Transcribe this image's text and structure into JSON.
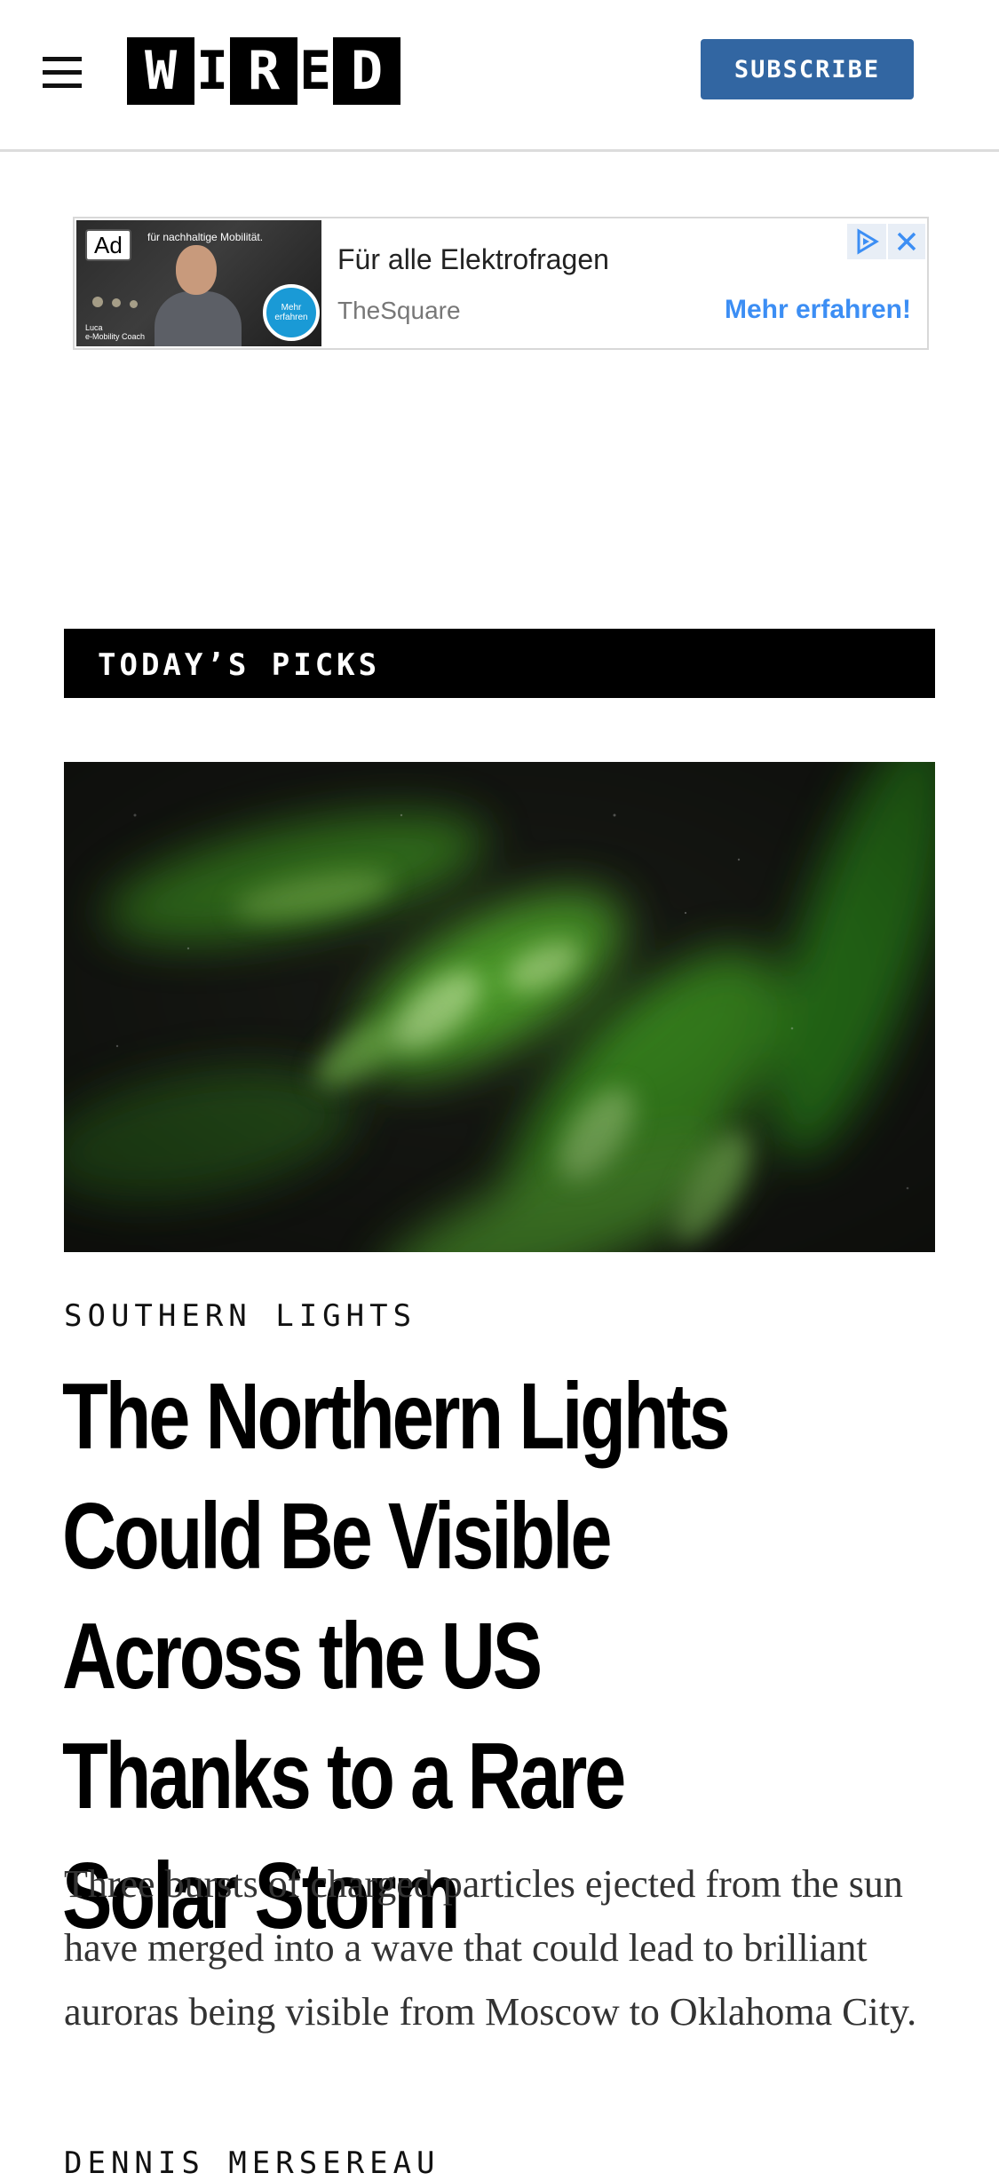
{
  "header": {
    "menu_icon": "hamburger-menu-icon",
    "logo_letters": [
      "W",
      "I",
      "R",
      "E",
      "D"
    ],
    "subscribe_label": "SUBSCRIBE",
    "subscribe_color": "#3266a2"
  },
  "ad": {
    "label": "Ad",
    "image_tagline": "für nachhaltige Mobilität.",
    "image_badge": "Mehr erfahren",
    "image_caption": "Luca\ne-Mobility Coach",
    "headline": "Für alle Elektrofragen",
    "source": "TheSquare",
    "cta": "Mehr erfahren!",
    "cta_color": "#3c8ef4",
    "adchoices_icon": "adchoices-icon",
    "close_icon": "close-icon"
  },
  "section": {
    "title": "TODAY’S PICKS"
  },
  "article": {
    "image_alt": "aurora-photo",
    "kicker": "SOUTHERN LIGHTS",
    "headline": "The Northern Lights Could Be Visible Across the US Thanks to a Rare Solar Storm",
    "dek": "Three bursts of charged particles ejected from the sun have merged into a wave that could lead to brilliant auroras being visible from Moscow to Oklahoma City.",
    "byline": "DENNIS MERSEREAU"
  }
}
